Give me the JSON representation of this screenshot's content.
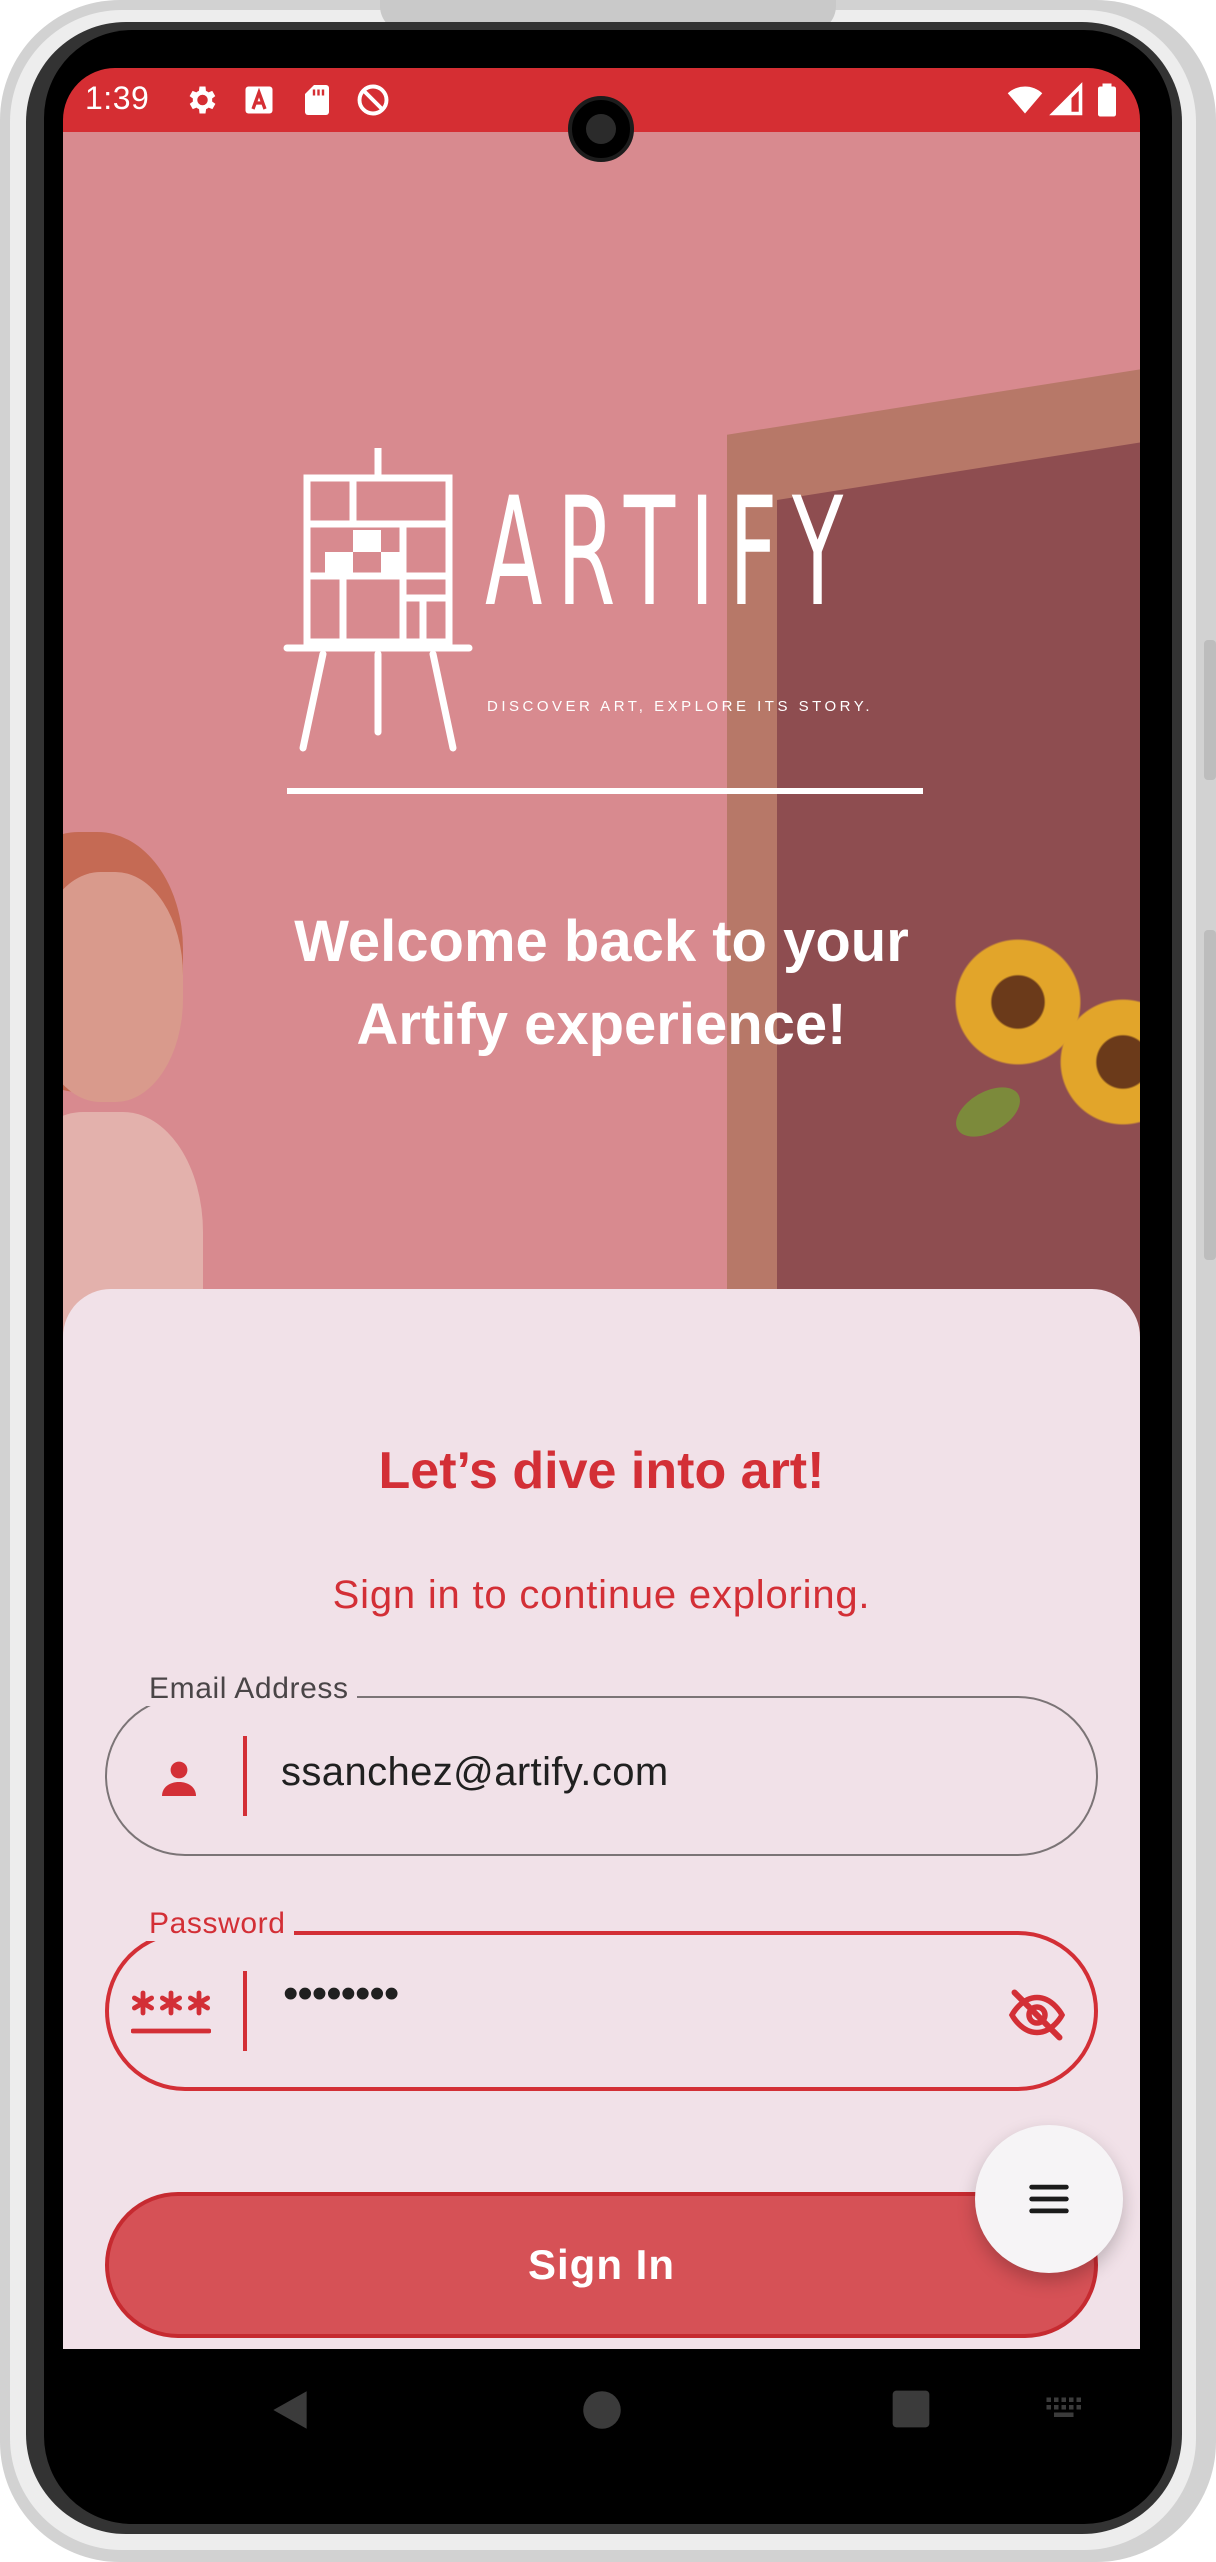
{
  "status_bar": {
    "time": "1:39",
    "icons": [
      "settings-icon",
      "font-a-icon",
      "sd-card-icon",
      "do-not-disturb-icon"
    ],
    "right_icons": [
      "wifi-icon",
      "signal-icon",
      "battery-icon"
    ],
    "color": "#d52e33"
  },
  "hero": {
    "brand_name": "ARTIFY",
    "tagline": "DISCOVER ART, EXPLORE ITS STORY.",
    "welcome_line1": "Welcome back to your",
    "welcome_line2": "Artify experience!",
    "overlay_color": "#d88a8f"
  },
  "login": {
    "title": "Let’s dive into art!",
    "subtitle": "Sign in to continue exploring.",
    "email": {
      "label": "Email Address",
      "value": "ssanchez@artify.com",
      "icon": "person-icon"
    },
    "password": {
      "label": "Password",
      "value": "••••••••",
      "icon": "password-asterisk-icon",
      "toggle_icon": "visibility-off-icon"
    },
    "signin_label": "Sign In",
    "menu_icon": "menu-icon",
    "accent_color": "#d32f36"
  },
  "nav_bar": {
    "buttons": [
      "back-icon",
      "home-icon",
      "recents-icon",
      "keyboard-icon"
    ]
  }
}
